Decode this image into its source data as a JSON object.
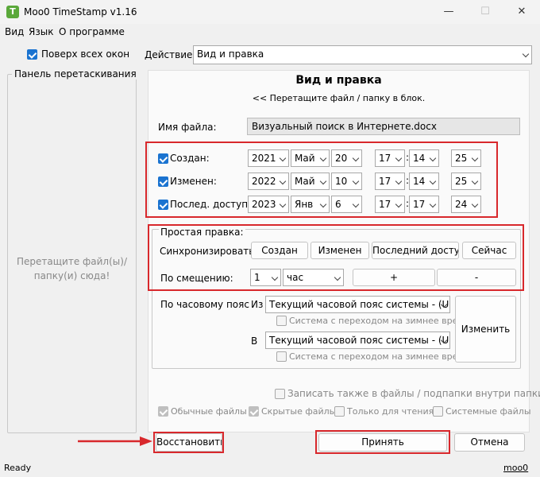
{
  "window": {
    "title": "Moo0 TimeStamp v1.16",
    "app_icon_letter": "T",
    "minimize_glyph": "—",
    "maximize_glyph": "☐",
    "close_glyph": "✕"
  },
  "menu": [
    "Вид",
    "Язык",
    "О программе"
  ],
  "left": {
    "always_on_top": "Поверх всех окон",
    "drag_panel_title": "Панель перетаскивания",
    "drag_hint": "Перетащите файл(ы)/папку(и) сюда!"
  },
  "action": {
    "label": "Действие:",
    "value": "Вид и правка"
  },
  "main": {
    "heading": "Вид и правка",
    "subheading": "<< Перетащите файл / папку в блок.",
    "filename_label": "Имя файла:",
    "filename_value": "Визуальный поиск в Интернете.docx"
  },
  "dates": [
    {
      "label": "Создан:",
      "checked": true,
      "year": "2021",
      "month": "Май",
      "day": "20",
      "hour": "17",
      "minute": "14",
      "second": "25"
    },
    {
      "label": "Изменен:",
      "checked": true,
      "year": "2022",
      "month": "Май",
      "day": "10",
      "hour": "17",
      "minute": "14",
      "second": "25"
    },
    {
      "label": "Послед. доступ:",
      "checked": true,
      "year": "2023",
      "month": "Янв",
      "day": "6",
      "hour": "17",
      "minute": "17",
      "second": "24"
    }
  ],
  "simple_edit": {
    "title": "Простая правка:",
    "sync_label": "Синхронизировать:",
    "sync_buttons": [
      "Создан",
      "Изменен",
      "Последний доступ",
      "Сейчас"
    ],
    "offset_label": "По смещению:",
    "offset_value": "1",
    "offset_unit": "час",
    "plus": "+",
    "minus": "-"
  },
  "timezone": {
    "label": "По часовому поясу",
    "from_label": "Из",
    "to_label": "В",
    "from_value": "Текущий часовой пояс системы - (U",
    "to_value": "Текущий часовой пояс системы - (U",
    "dst_label": "Система с переходом на зимнее время",
    "change_button": "Изменить"
  },
  "options": {
    "subfolders": "Записать также в файлы / подпапки внутри папки",
    "normal_files": "Обычные файлы",
    "hidden_files": "Скрытые файлы",
    "readonly": "Только для чтения",
    "system_files": "Системные файлы"
  },
  "buttons": {
    "restore": "Восстановить",
    "apply": "Принять",
    "cancel": "Отмена"
  },
  "status": {
    "text": "Ready",
    "link": "moo0"
  },
  "colors": {
    "accent": "#1a73d0",
    "highlight": "#d8282c"
  }
}
